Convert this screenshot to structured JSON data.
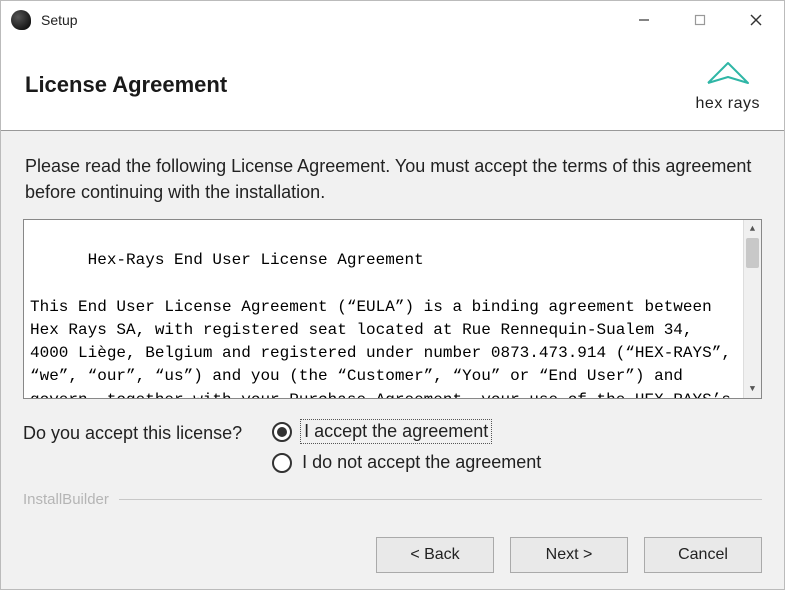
{
  "titlebar": {
    "title": "Setup"
  },
  "header": {
    "title": "License Agreement",
    "brand": "hex rays"
  },
  "body": {
    "instruction": "Please read the following License Agreement. You must accept the terms of this agreement before continuing with the installation.",
    "eula_text": "Hex-Rays End User License Agreement\n\nThis End User License Agreement (“EULA”) is a binding agreement between Hex Rays SA, with registered seat located at Rue Rennequin-Sualem 34, 4000 Liège, Belgium and registered under number 0873.473.914 (“HEX-RAYS”, “we”, “our”, “us”) and you (the “Customer”, “You” or “End User”) and govern, together with your Purchase Agreement, your use of the HEX-RAYS’s software",
    "accept_question": "Do you accept this license?",
    "radio_accept": "I accept the agreement",
    "radio_reject": "I do not accept the agreement",
    "selected": "accept",
    "builder": "InstallBuilder"
  },
  "footer": {
    "back": "< Back",
    "next": "Next >",
    "cancel": "Cancel"
  }
}
